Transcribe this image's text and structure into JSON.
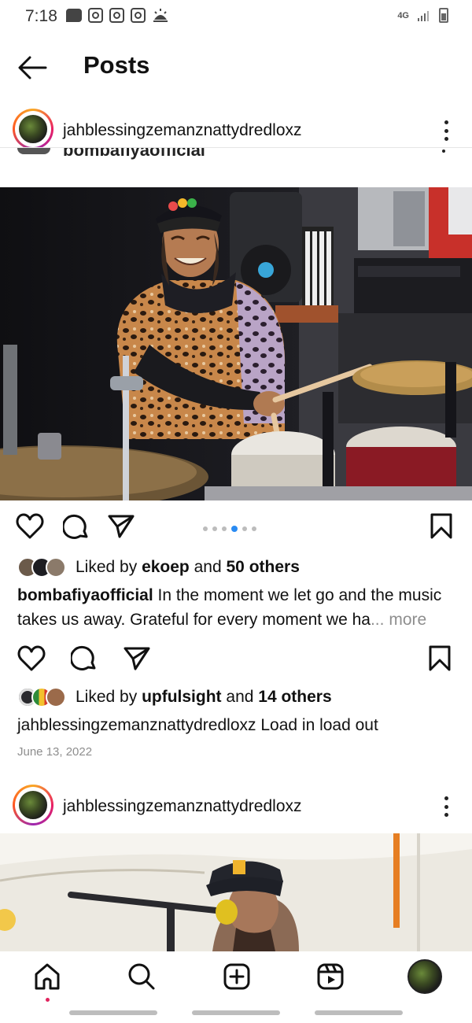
{
  "status_bar": {
    "time": "7:18",
    "network": "4G"
  },
  "header": {
    "title": "Posts"
  },
  "post1": {
    "username": "jahblessingzemanznattydredloxz",
    "tagged_account": "bombafiyaofficial",
    "carousel": {
      "count": 6,
      "active_index": 3
    },
    "likes": {
      "prefix": "Liked by",
      "user": "ekoep",
      "and": "and",
      "others": "50 others"
    },
    "caption": {
      "username": "bombafiyaofficial",
      "text": "In the moment we let go and the music takes us away. Grateful for every moment we ha",
      "ellipsis": "...",
      "more": "more"
    }
  },
  "post1b": {
    "likes": {
      "prefix": "Liked by",
      "user": "upfulsight",
      "and": "and",
      "others": "14 others"
    },
    "caption": {
      "username": "jahblessingzemanznattydredloxz",
      "text": "Load in load out"
    },
    "date": "June 13, 2022"
  },
  "post2": {
    "username": "jahblessingzemanznattydredloxz"
  },
  "colors": {
    "accent_blue": "#2a8bf2",
    "notification_dot": "#e0245e",
    "muted_text": "#8e8e8e"
  },
  "nav": {
    "items": [
      "home-icon",
      "search-icon",
      "create-post-icon",
      "reels-icon",
      "profile-avatar"
    ]
  }
}
